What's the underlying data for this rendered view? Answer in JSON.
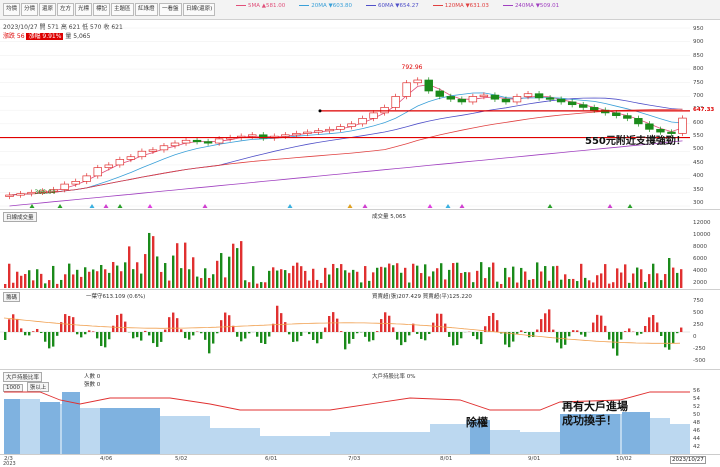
{
  "toolbar": {
    "buttons": [
      "均價",
      "分價",
      "還原",
      "左方",
      "光標",
      "標記",
      "主題區",
      "紅綠燈",
      "一看盤",
      "日線(還原)"
    ]
  },
  "ma_legend": [
    {
      "label": "5MA ▲581.00",
      "color": "#e0507a"
    },
    {
      "label": "20MA ▼603.80",
      "color": "#3aa0d8"
    },
    {
      "label": "60MA ▼654.27",
      "color": "#5050c8"
    },
    {
      "label": "120MA ▼631.03",
      "color": "#e04040"
    },
    {
      "label": "240MA ▼509.01",
      "color": "#a040c0"
    }
  ],
  "info": {
    "date": "2023/10/27",
    "open": "開 571",
    "high": "高 621",
    "low": "低 570",
    "close": "收 621",
    "change": "漲跌 56",
    "pct": "漲幅 9.91%",
    "volume": "量 5,065"
  },
  "price_axis": [
    "950",
    "900",
    "850",
    "800",
    "750",
    "700",
    "650",
    "600",
    "550",
    "500",
    "450",
    "400",
    "350",
    "300"
  ],
  "price_labels": {
    "high_label": "792.96",
    "low_label": "366.04",
    "right_value": "647.33"
  },
  "annotations": {
    "support": "550元附近支撐強勁！",
    "ex_rights": "除權",
    "big_buyers": "再有大戶進場\n成功換手！"
  },
  "volume_panel": {
    "title": "日線成交量",
    "legend": "成交量 5,065",
    "axis": [
      "12000",
      "10000",
      "8000",
      "6000",
      "4000",
      "2000"
    ]
  },
  "chip_panel": {
    "title": "籌碼",
    "legend_left": "一葉守613.109 (0.6%)",
    "legend_right": "買賣超(張)207.429 買賣超(平)125.220",
    "axis": [
      "750",
      "500",
      "250",
      "0",
      "-250",
      "-500"
    ]
  },
  "holder_panel": {
    "title": "大戶持股比率",
    "select_value": "1000",
    "select_suffix": "張以上",
    "legend_people": "人數 0",
    "legend_holders": "張數 0",
    "legend_right": "大戶持股比率 0%",
    "axis": [
      "56",
      "54",
      "52",
      "50",
      "48",
      "46",
      "44",
      "42"
    ]
  },
  "x_axis": {
    "labels": [
      "2/3",
      "4/06",
      "5/02",
      "6/01",
      "7/03",
      "8/01",
      "9/01",
      "10/02"
    ],
    "year": "2023",
    "end_date": "2023/10/27"
  },
  "chart_data": {
    "type": "candlestick",
    "dates_range": [
      "2023/02/03",
      "2023/10/27"
    ],
    "close_approx": [
      340,
      345,
      350,
      355,
      360,
      380,
      390,
      410,
      440,
      450,
      470,
      480,
      500,
      505,
      520,
      530,
      540,
      535,
      530,
      545,
      550,
      555,
      560,
      548,
      555,
      560,
      565,
      570,
      575,
      580,
      590,
      600,
      620,
      640,
      660,
      700,
      750,
      760,
      720,
      700,
      690,
      680,
      700,
      705,
      690,
      680,
      700,
      710,
      695,
      690,
      680,
      670,
      660,
      650,
      640,
      630,
      620,
      600,
      580,
      570,
      565,
      621
    ],
    "support_line": 550,
    "resistance_line": 647.33,
    "high": 792.96,
    "low": 366.04,
    "ylim": [
      300,
      950
    ]
  },
  "colors": {
    "up": "#e03030",
    "down": "#1a8a1a",
    "bg": "#ffffff",
    "accent": "#d00000"
  }
}
